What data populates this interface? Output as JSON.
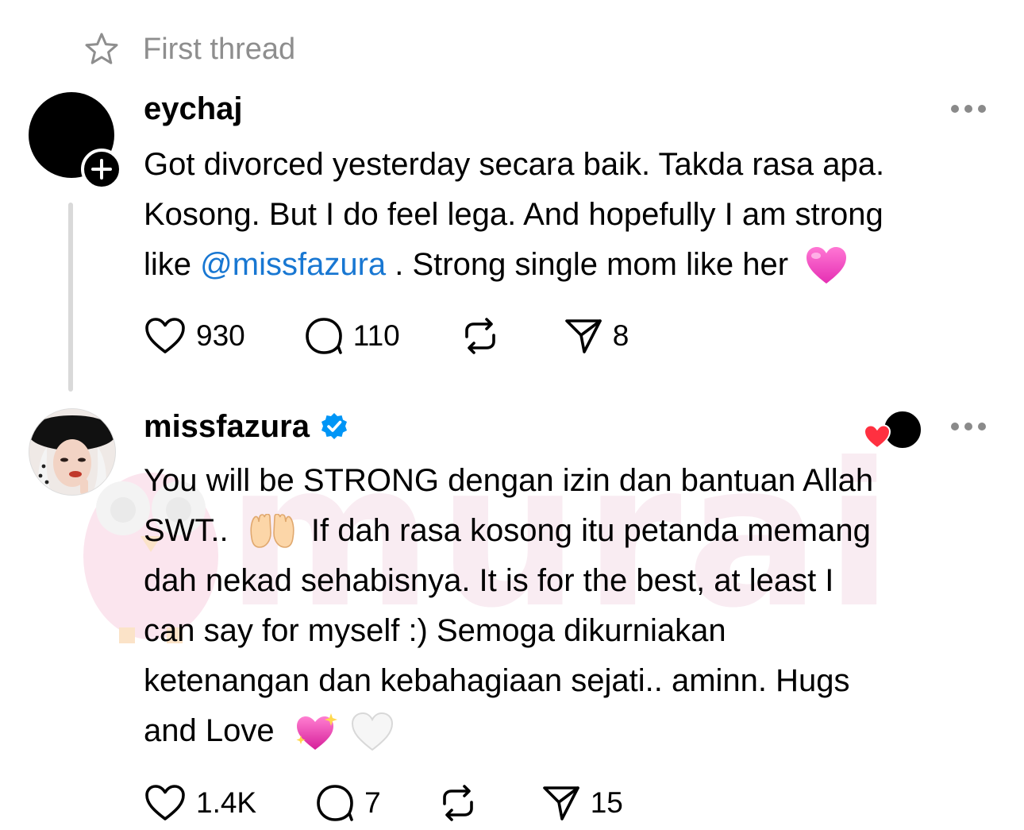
{
  "header": {
    "title": "First thread",
    "icon": "star-icon"
  },
  "watermark": {
    "text": "murai"
  },
  "posts": [
    {
      "username": "eychaj",
      "text_parts": {
        "line1": "Got divorced yesterday secara baik. Takda rasa apa.",
        "line2": "Kosong. But I do feel lega. And hopefully I am strong",
        "like_word": "like",
        "mention": "@missfazura",
        "after_mention": ". Strong single mom like her"
      },
      "emoji": "pink-heart-emoji",
      "stats": {
        "likes": "930",
        "replies": "110",
        "reposts": "",
        "shares": "8"
      }
    },
    {
      "username": "missfazura",
      "verified": true,
      "text_parts": {
        "line1": "You will be STRONG dengan izin dan bantuan Allah",
        "line2a": "SWT..",
        "line2b": "If dah rasa kosong itu petanda memang",
        "line3": "dah nekad sehabisnya. It is for the best, at least I",
        "line4": "can say for myself :) Semoga dikurniakan",
        "line5": "ketenangan dan kebahagiaan sejati.. aminn. Hugs",
        "line6": "and Love"
      },
      "emojis": [
        "palms-up-together-emoji",
        "sparkling-heart-emoji",
        "white-heart-emoji"
      ],
      "stats": {
        "likes": "1.4K",
        "replies": "7",
        "reposts": "",
        "shares": "15"
      }
    }
  ],
  "colors": {
    "mention": "#1877d2",
    "verified": "#0095f6",
    "muted": "#8e8e8e",
    "like_red": "#ff3040",
    "thread_line": "#d9d9d9"
  }
}
